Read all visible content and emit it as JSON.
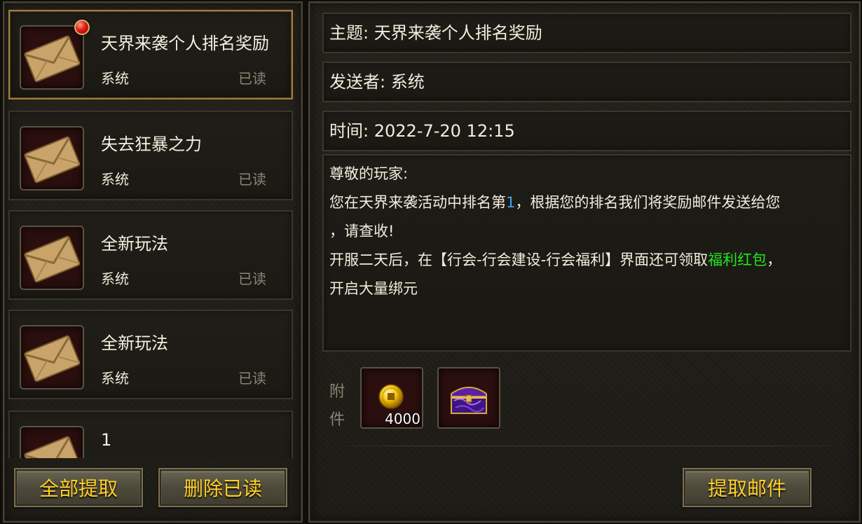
{
  "mail_list": [
    {
      "title": "天界来袭个人排名奖励",
      "sender": "系统",
      "status": "已读",
      "selected": true,
      "unread_badge": true,
      "icon": "envelope-icon"
    },
    {
      "title": "失去狂暴之力",
      "sender": "系统",
      "status": "已读",
      "selected": false,
      "unread_badge": false,
      "icon": "envelope-icon"
    },
    {
      "title": "全新玩法",
      "sender": "系统",
      "status": "已读",
      "selected": false,
      "unread_badge": false,
      "icon": "envelope-icon"
    },
    {
      "title": "全新玩法",
      "sender": "系统",
      "status": "已读",
      "selected": false,
      "unread_badge": false,
      "icon": "envelope-icon"
    },
    {
      "title": "1",
      "sender": "",
      "status": "",
      "selected": false,
      "unread_badge": false,
      "icon": "envelope-icon"
    }
  ],
  "buttons": {
    "claim_all": "全部提取",
    "delete_read": "删除已读",
    "claim_mail": "提取邮件"
  },
  "detail": {
    "subject": "主题: 天界来袭个人排名奖励",
    "sender": "发送者: 系统",
    "time": "时间: 2022-7-20 12:15",
    "body": {
      "greeting": "尊敬的玩家:",
      "line2_a": "您在天界来袭活动中排名第",
      "line2_rank": "1",
      "line2_b": "，根据您的排名我们将奖励邮件发送给您",
      "line3": "，请查收!",
      "line4_a": "开服二天后，在【行会-行会建设-行会福利】界面还可领取",
      "line4_link": "福利红包",
      "line4_b": "，",
      "line5": "开启大量绑元"
    },
    "attachment_label_1": "附",
    "attachment_label_2": "件",
    "attachments": [
      {
        "icon": "gold-coin-icon",
        "count": "4000"
      },
      {
        "icon": "treasure-chest-icon",
        "count": ""
      }
    ]
  },
  "colors": {
    "button_text": "#ffcf2a",
    "rank_highlight": "#3aa4ff",
    "link_highlight": "#1fe81f",
    "selected_border": "#a07d3c",
    "read_status": "#8c8575"
  }
}
